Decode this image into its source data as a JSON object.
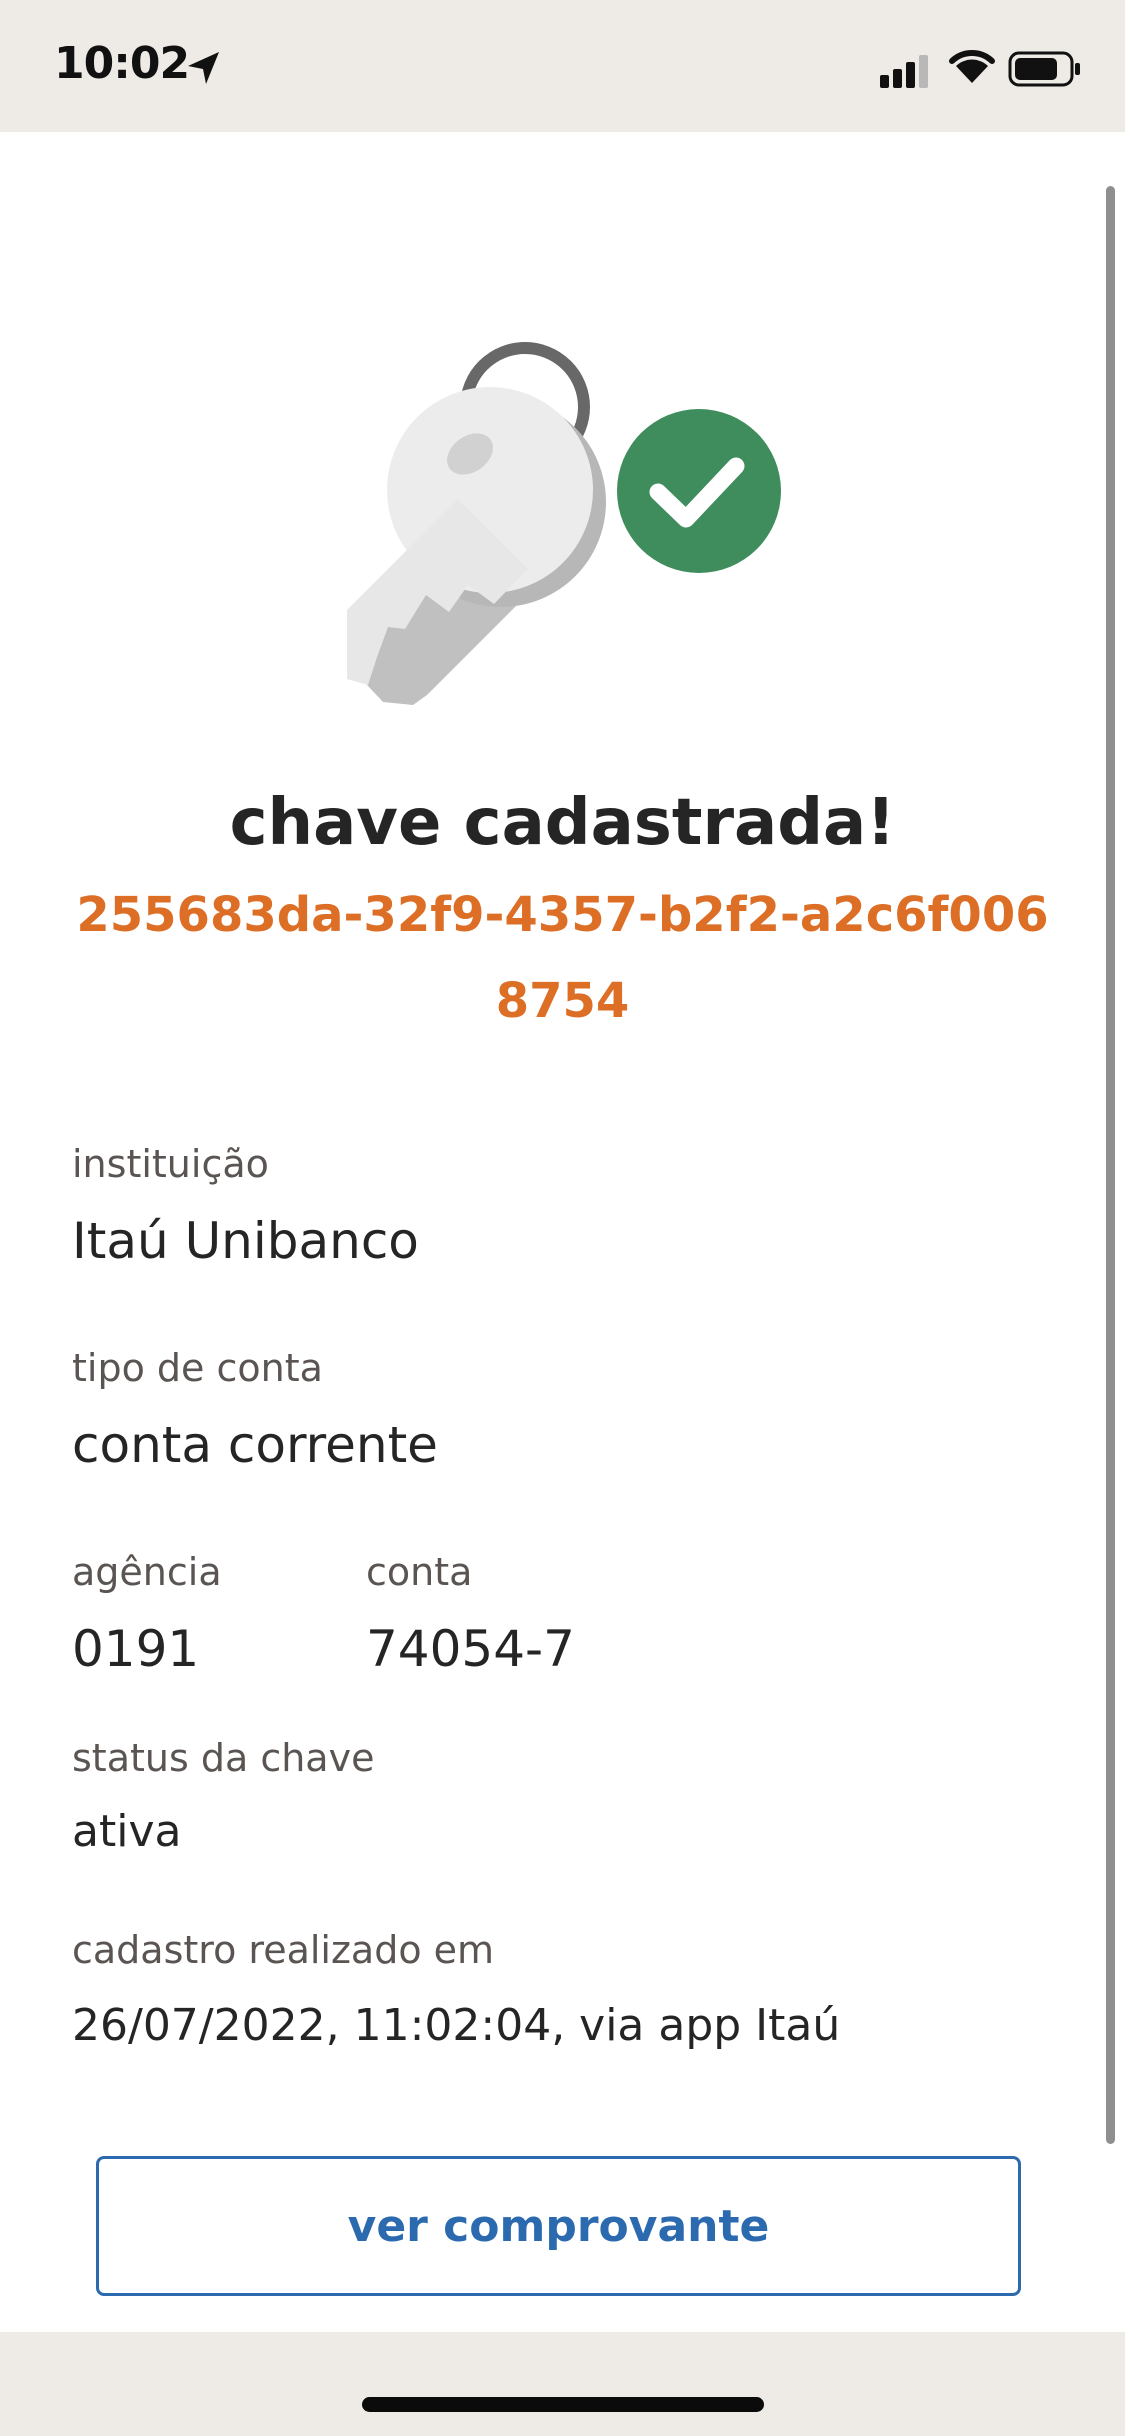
{
  "status_bar": {
    "time": "10:02",
    "location_icon": "location-arrow-icon",
    "signal_icon": "cellular-signal-icon",
    "wifi_icon": "wifi-icon",
    "battery_icon": "battery-icon"
  },
  "illustration": {
    "icon": "key-with-check-icon",
    "check_color": "#3f8c5d"
  },
  "header": {
    "title": "chave cadastrada!",
    "key_id": "255683da-32f9-4357-b2f2-a2c6f0068754"
  },
  "details": {
    "institution": {
      "label": "instituição",
      "value": "Itaú Unibanco"
    },
    "account_type": {
      "label": "tipo de conta",
      "value": "conta corrente"
    },
    "agency": {
      "label": "agência",
      "value": "0191"
    },
    "account": {
      "label": "conta",
      "value": "74054-7"
    },
    "key_status": {
      "label": "status da chave",
      "value": "ativa"
    },
    "registration": {
      "label": "cadastro realizado em",
      "value": "26/07/2022, 11:02:04, via app Itaú"
    }
  },
  "actions": {
    "view_receipt": "ver comprovante"
  },
  "colors": {
    "accent_orange": "#dd6e25",
    "button_blue": "#2b6aae",
    "success_green": "#3f8c5d",
    "status_background": "#eeebe7"
  }
}
